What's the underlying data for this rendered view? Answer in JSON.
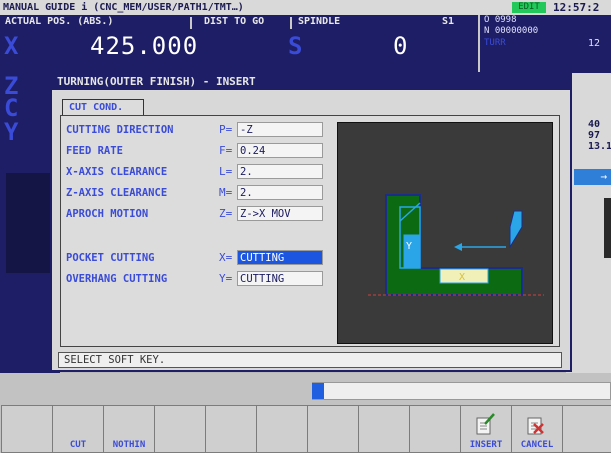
{
  "status_bar": {
    "title": "MANUAL GUIDE i (CNC_MEM/USER/PATH1/TMT…)",
    "mode": "EDIT",
    "time": "12:57:2"
  },
  "header": {
    "actual_pos_label": "ACTUAL POS. (ABS.)",
    "dist_to_go_label": "DIST TO GO",
    "spindle_label": "SPINDLE",
    "spindle_id": "S1",
    "axis_x_letter": "X",
    "axis_x_value": "425.000",
    "spindle_letter": "S",
    "spindle_value": "0",
    "o_number": "O 0998",
    "n_number": "N 00000000",
    "turr_label": "TURR",
    "turr_value": "12"
  },
  "axis_letters": [
    "Z",
    "C",
    "Y"
  ],
  "right_strip": {
    "values": [
      "40",
      "97",
      "13.1"
    ],
    "arrow": "→"
  },
  "dialog": {
    "title": "TURNING(OUTER FINISH) - INSERT",
    "tab_label": "CUT COND.",
    "rows": [
      {
        "label": "CUTTING DIRECTION",
        "letter": "P=",
        "value": "-Z"
      },
      {
        "label": "FEED RATE",
        "letter": "F=",
        "value": "0.24"
      },
      {
        "label": "X-AXIS CLEARANCE",
        "letter": "L=",
        "value": "2."
      },
      {
        "label": "Z-AXIS CLEARANCE",
        "letter": "M=",
        "value": "2."
      },
      {
        "label": "APROCH MOTION",
        "letter": "Z=",
        "value": "Z->X MOV"
      },
      {
        "label": "POCKET CUTTING",
        "letter": "X=",
        "value": "CUTTING"
      },
      {
        "label": "OVERHANG CUTTING",
        "letter": "Y=",
        "value": "CUTTING"
      }
    ],
    "graphic": {
      "y_marker": "Y",
      "x_marker": "X"
    },
    "message": "SELECT SOFT KEY."
  },
  "progress_fraction": 0.04,
  "softkeys": [
    {
      "label": ""
    },
    {
      "label": "CUT"
    },
    {
      "label": "NOTHIN"
    },
    {
      "label": ""
    },
    {
      "label": ""
    },
    {
      "label": ""
    },
    {
      "label": ""
    },
    {
      "label": ""
    },
    {
      "label": ""
    },
    {
      "label": "INSERT",
      "icon": "insert-icon"
    },
    {
      "label": "CANCEL",
      "icon": "cancel-icon"
    },
    {
      "label": ""
    }
  ],
  "colors": {
    "header_bg": "#1e1e66",
    "accent_text": "#3a4bd8",
    "selected_field": "#1b55e0",
    "workpiece_green": "#0c6b12",
    "tool_blue": "#2aa6e8",
    "edit_badge": "#22c95a"
  }
}
